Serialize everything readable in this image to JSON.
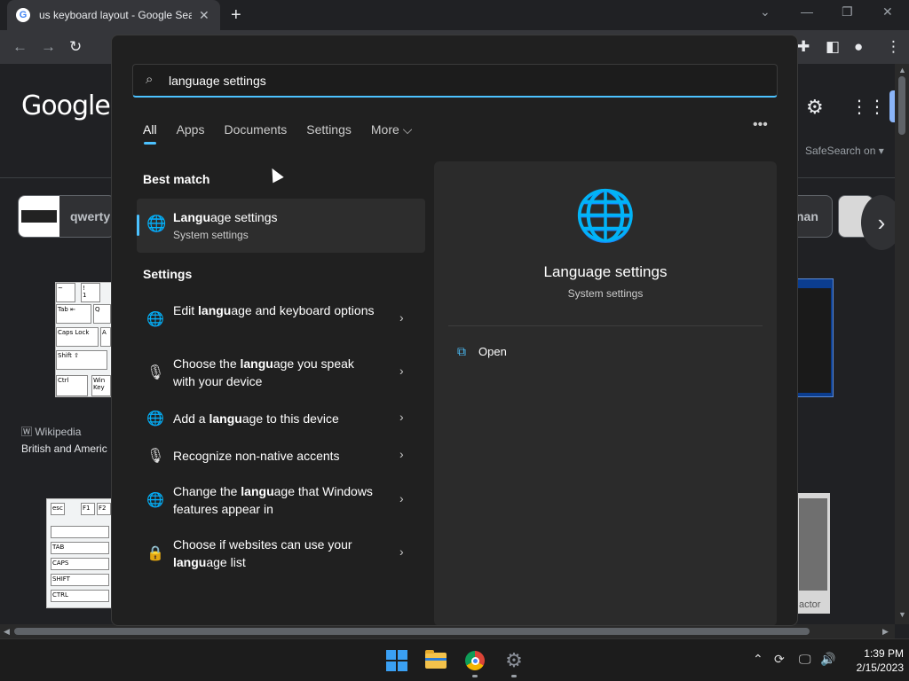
{
  "browser": {
    "tab_title": "us keyboard layout - Google Sea",
    "new_tab": "+",
    "close": "✕",
    "win_min": "—",
    "win_restore": "❐",
    "win_close": "✕",
    "win_collapse": "⌄"
  },
  "google": {
    "logo": "Google",
    "safesearch": "SafeSearch on",
    "chip_left": "qwerty",
    "chip_right": "nan",
    "wiki_source": "Wikipedia",
    "wiki_title": "British and Americ",
    "actor_text": "actor"
  },
  "search": {
    "query": "language settings",
    "filters": [
      "All",
      "Apps",
      "Documents",
      "Settings",
      "More"
    ],
    "more_arrow": "⌵",
    "ellipsis": "•••"
  },
  "best_match": {
    "heading": "Best match",
    "title_bold": "Langu",
    "title_rest": "age settings",
    "subtitle": "System settings"
  },
  "settings_section": {
    "heading": "Settings",
    "items": [
      {
        "pre": "Edit ",
        "bold": "langu",
        "post": "age and keyboard options"
      },
      {
        "pre": "Choose the ",
        "bold": "langu",
        "post": "age you speak with your device"
      },
      {
        "pre": "Add a ",
        "bold": "langu",
        "post": "age to this device"
      },
      {
        "pre": "",
        "bold": "",
        "post": "Recognize non-native accents"
      },
      {
        "pre": "Change the ",
        "bold": "langu",
        "post": "age that Windows features appear in"
      },
      {
        "pre": "Choose if websites can use your ",
        "bold": "langu",
        "post": "age list"
      }
    ]
  },
  "detail": {
    "title": "Language settings",
    "subtitle": "System settings",
    "open_label": "Open"
  },
  "taskbar": {
    "time": "1:39 PM",
    "date": "2/15/2023"
  },
  "colors": {
    "accent": "#4cc2ff",
    "flyout_bg": "#202020"
  }
}
